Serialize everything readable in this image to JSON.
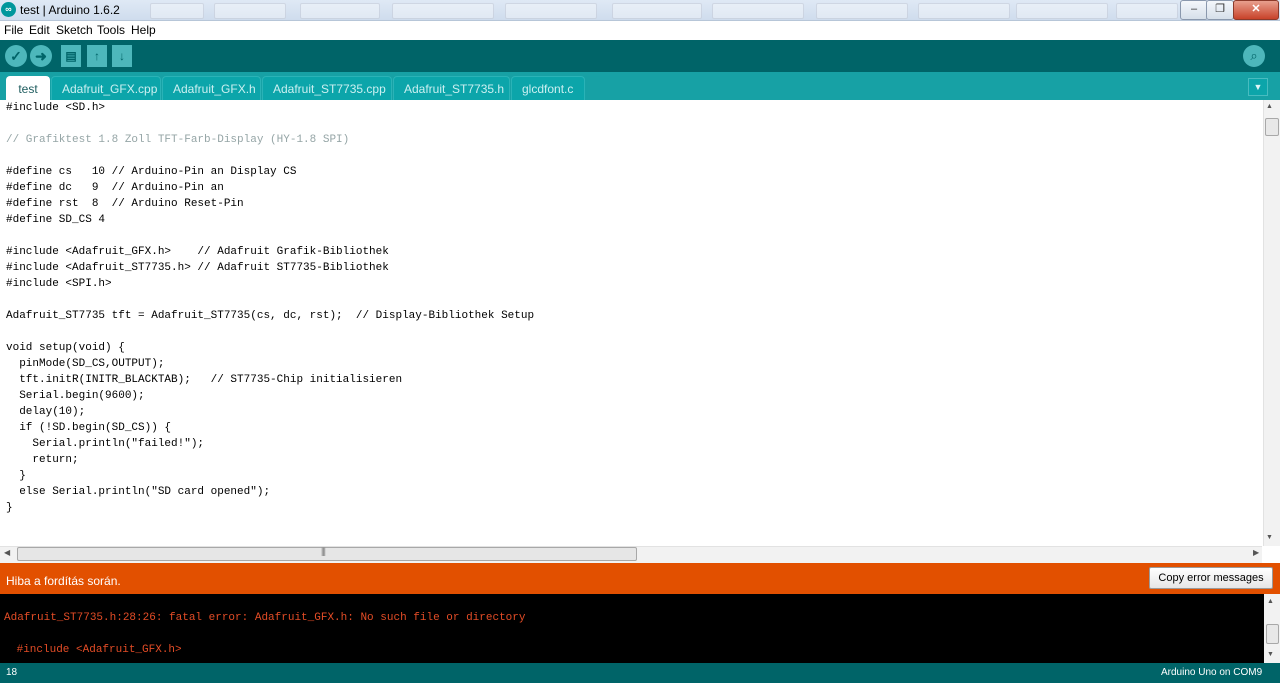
{
  "window": {
    "title": "test | Arduino 1.6.2",
    "icon": "arduino-logo-icon",
    "controls": {
      "minimize": "‒",
      "maximize": "❐",
      "close": "✕"
    }
  },
  "menu": [
    "File",
    "Edit",
    "Sketch",
    "Tools",
    "Help"
  ],
  "toolbar": {
    "verify": "✓",
    "upload": "➜",
    "new": "▤",
    "open": "↑",
    "save": "↓",
    "serial_monitor": "⌕",
    "icons": [
      "check-icon",
      "arrow-right-icon",
      "new-file-icon",
      "open-icon",
      "save-icon",
      "magnifier-icon"
    ]
  },
  "tabs": [
    {
      "label": "test",
      "active": true
    },
    {
      "label": "Adafruit_GFX.cpp",
      "active": false
    },
    {
      "label": "Adafruit_GFX.h",
      "active": false
    },
    {
      "label": "Adafruit_ST7735.cpp",
      "active": false
    },
    {
      "label": "Adafruit_ST7735.h",
      "active": false
    },
    {
      "label": "glcdfont.c",
      "active": false
    }
  ],
  "tab_menu": "▼",
  "code_lines": [
    "#include <SD.h>",
    "",
    "// Grafiktest 1.8 Zoll TFT-Farb-Display (HY-1.8 SPI)",
    "",
    "#define cs   10 // Arduino-Pin an Display CS",
    "#define dc   9  // Arduino-Pin an",
    "#define rst  8  // Arduino Reset-Pin",
    "#define SD_CS 4",
    "",
    "#include <Adafruit_GFX.h>    // Adafruit Grafik-Bibliothek",
    "#include <Adafruit_ST7735.h> // Adafruit ST7735-Bibliothek",
    "#include <SPI.h>",
    "",
    "Adafruit_ST7735 tft = Adafruit_ST7735(cs, dc, rst);  // Display-Bibliothek Setup",
    "",
    "void setup(void) {",
    "  pinMode(SD_CS,OUTPUT);",
    "  tft.initR(INITR_BLACKTAB);   // ST7735-Chip initialisieren",
    "  Serial.begin(9600);",
    "  delay(10);",
    "  if (!SD.begin(SD_CS)) {",
    "    Serial.println(\"failed!\");",
    "    return;",
    "  }",
    "  else Serial.println(\"SD card opened\");",
    "}"
  ],
  "scroll": {
    "up": "▲",
    "down": "▼",
    "left": "◀",
    "right": "▶",
    "grip": "|||"
  },
  "error": {
    "title": "Hiba a fordítás során.",
    "copy_button": "Copy error messages",
    "color": "#e25000"
  },
  "console_lines": [
    "Adafruit_ST7735.h:28:26: fatal error: Adafruit_GFX.h: No such file or directory",
    " #include <Adafruit_GFX.h>"
  ],
  "status": {
    "line": "18",
    "board": "Arduino Uno on COM9"
  },
  "colors": {
    "teal_dark": "#006468",
    "teal_tabs": "#17a1a5",
    "console_text": "#e34c26"
  }
}
